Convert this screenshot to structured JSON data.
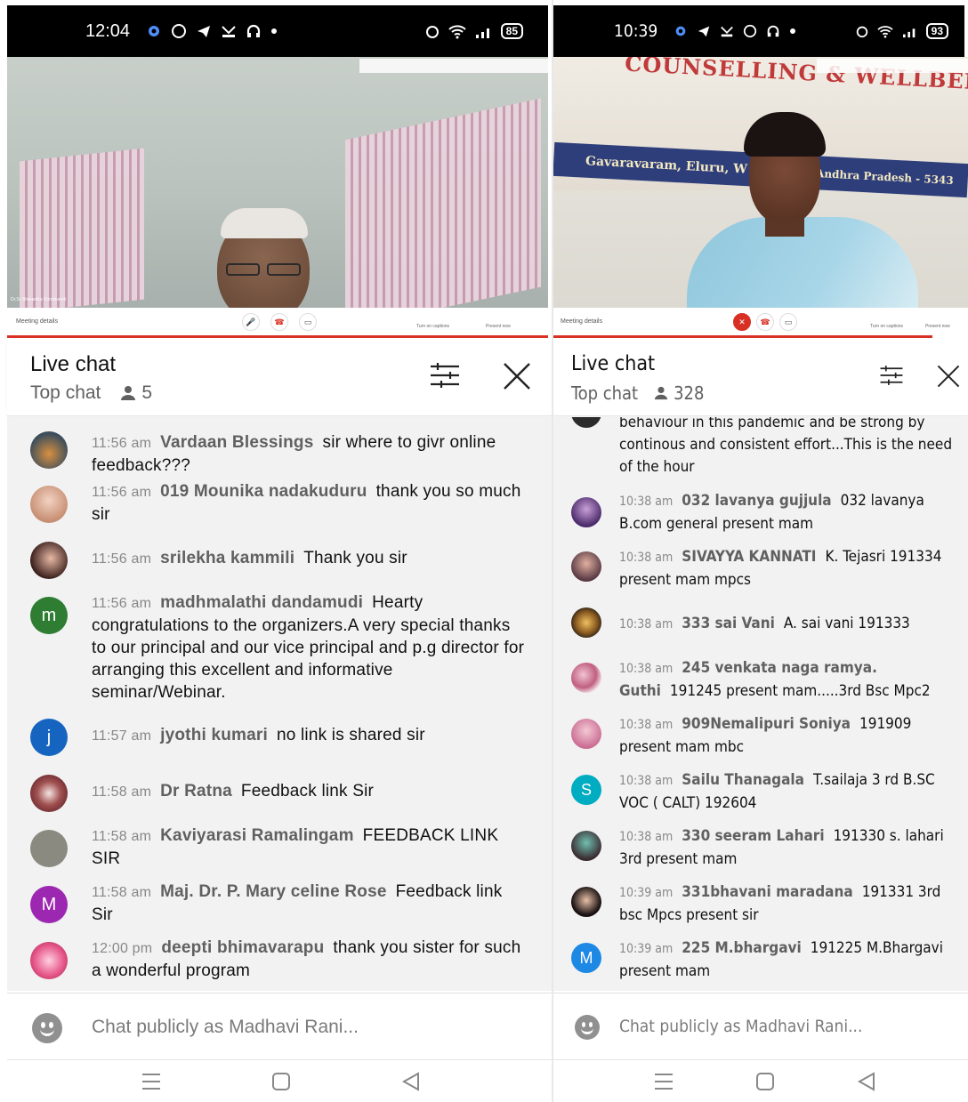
{
  "left": {
    "status": {
      "time": "12:04",
      "battery": "85"
    },
    "video": {
      "speaker_tag": "Dr.Sr Shiwanika Kondaveeti",
      "meeting_details": "Meeting details",
      "captions": "Turn on captions",
      "present": "Present now"
    },
    "chat": {
      "title": "Live chat",
      "subtitle": "Top chat",
      "viewers": "5",
      "input_placeholder": "Chat publicly as Madhavi Rani...",
      "messages": [
        {
          "time": "11:56 am",
          "author": "Vardaan Blessings",
          "text": "sir where to givr online feedback???",
          "avatar": ""
        },
        {
          "time": "11:56 am",
          "author": "019 Mounika nadakuduru",
          "text": "thank you so much sir",
          "avatar": ""
        },
        {
          "time": "11:56 am",
          "author": "srilekha kammili",
          "text": "Thank you sir",
          "avatar": ""
        },
        {
          "time": "11:56 am",
          "author": "madhmalathi dandamudi",
          "text": "Hearty congratulations to the organizers.A very special thanks to our principal and our vice principal and p.g director for arranging this excellent and informative seminar/Webinar.",
          "avatar": "m"
        },
        {
          "time": "11:57 am",
          "author": "jyothi kumari",
          "text": "no link is shared sir",
          "avatar": "j"
        },
        {
          "time": "11:58 am",
          "author": "Dr Ratna",
          "text": "Feedback link Sir",
          "avatar": ""
        },
        {
          "time": "11:58 am",
          "author": "Kaviyarasi Ramalingam",
          "text": "FEEDBACK LINK SIR",
          "avatar": ""
        },
        {
          "time": "11:58 am",
          "author": "Maj. Dr. P. Mary celine Rose",
          "text": "Feedback link Sir",
          "avatar": "M"
        },
        {
          "time": "12:00 pm",
          "author": "deepti bhimavarapu",
          "text": "thank you sister for such a wonderful program",
          "avatar": ""
        }
      ]
    }
  },
  "right": {
    "status": {
      "time": "10:39",
      "battery": "93"
    },
    "video": {
      "banner_line1": "COUNSELLING & WELLBEING HUB",
      "banner_line2": "Gavaravaram, Eluru, W",
      "banner_line3": "Andhra Pradesh - 5343",
      "meeting_details": "Meeting details",
      "captions": "Turn on captions",
      "present": "Present now"
    },
    "chat": {
      "title": "Live chat",
      "subtitle": "Top chat",
      "viewers": "328",
      "input_placeholder": "Chat publicly as Madhavi Rani...",
      "partial_message": "behaviour in this pandemic and be strong by continous and consistent effort...This is the need of the hour",
      "messages": [
        {
          "time": "10:38 am",
          "author": "032 lavanya gujjula",
          "text": "032 lavanya B.com general present mam",
          "avatar": ""
        },
        {
          "time": "10:38 am",
          "author": "SIVAYYA KANNATI",
          "text": "K. Tejasri 191334 present mam mpcs",
          "avatar": ""
        },
        {
          "time": "10:38 am",
          "author": "333 sai Vani",
          "text": "A. sai vani 191333",
          "avatar": ""
        },
        {
          "time": "10:38 am",
          "author": "245 venkata naga ramya. Guthi",
          "text": "191245 present mam.....3rd Bsc Mpc2",
          "avatar": ""
        },
        {
          "time": "10:38 am",
          "author": "909Nemalipuri Soniya",
          "text": "191909 present mam mbc",
          "avatar": ""
        },
        {
          "time": "10:38 am",
          "author": "Sailu Thanagala",
          "text": "T.sailaja 3 rd B.SC VOC ( CALT) 192604",
          "avatar": "S"
        },
        {
          "time": "10:38 am",
          "author": "330 seeram Lahari",
          "text": "191330 s. lahari 3rd present mam",
          "avatar": ""
        },
        {
          "time": "10:39 am",
          "author": "331bhavani maradana",
          "text": "191331 3rd bsc Mpcs present sir",
          "avatar": ""
        },
        {
          "time": "10:39 am",
          "author": "225 M.bhargavi",
          "text": "191225 M.Bhargavi present mam",
          "avatar": "M"
        }
      ]
    }
  },
  "colors": {
    "accent_red": "#d93025",
    "avatar_green": "#2e7d32",
    "avatar_blue": "#1565c0",
    "avatar_purple": "#9c27b0",
    "avatar_teal": "#00acc1",
    "avatar_blue2": "#1e88e5"
  }
}
